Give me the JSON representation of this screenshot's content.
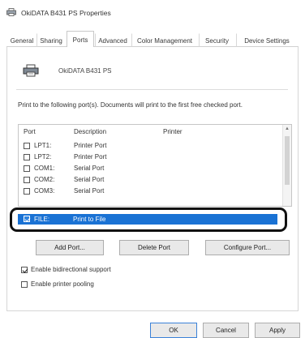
{
  "window": {
    "title": "OkiDATA B431 PS Properties"
  },
  "tabs": [
    {
      "label": "General"
    },
    {
      "label": "Sharing"
    },
    {
      "label": "Ports",
      "active": true
    },
    {
      "label": "Advanced"
    },
    {
      "label": "Color Management"
    },
    {
      "label": "Security"
    },
    {
      "label": "Device Settings"
    }
  ],
  "printer": {
    "name": "OkiDATA B431 PS"
  },
  "ports_section": {
    "description": "Print to the following port(s). Documents will print to the first free checked port.",
    "headers": {
      "port": "Port",
      "description": "Description",
      "printer": "Printer"
    },
    "rows": [
      {
        "port": "LPT1:",
        "description": "Printer Port",
        "checked": false
      },
      {
        "port": "LPT2:",
        "description": "Printer Port",
        "checked": false
      },
      {
        "port": "COM1:",
        "description": "Serial Port",
        "checked": false
      },
      {
        "port": "COM2:",
        "description": "Serial Port",
        "checked": false
      },
      {
        "port": "COM3:",
        "description": "Serial Port",
        "checked": false
      }
    ],
    "selected_row": {
      "port": "FILE:",
      "description": "Print to File",
      "checked": true
    }
  },
  "port_buttons": {
    "add": "Add Port...",
    "delete": "Delete Port",
    "configure": "Configure Port..."
  },
  "options": {
    "bidirectional": {
      "label": "Enable bidirectional support",
      "checked": true
    },
    "pooling": {
      "label": "Enable printer pooling",
      "checked": false
    }
  },
  "footer": {
    "ok": "OK",
    "cancel": "Cancel",
    "apply": "Apply"
  },
  "colors": {
    "selection": "#1a72d4",
    "highlight_ring": "#111111"
  }
}
